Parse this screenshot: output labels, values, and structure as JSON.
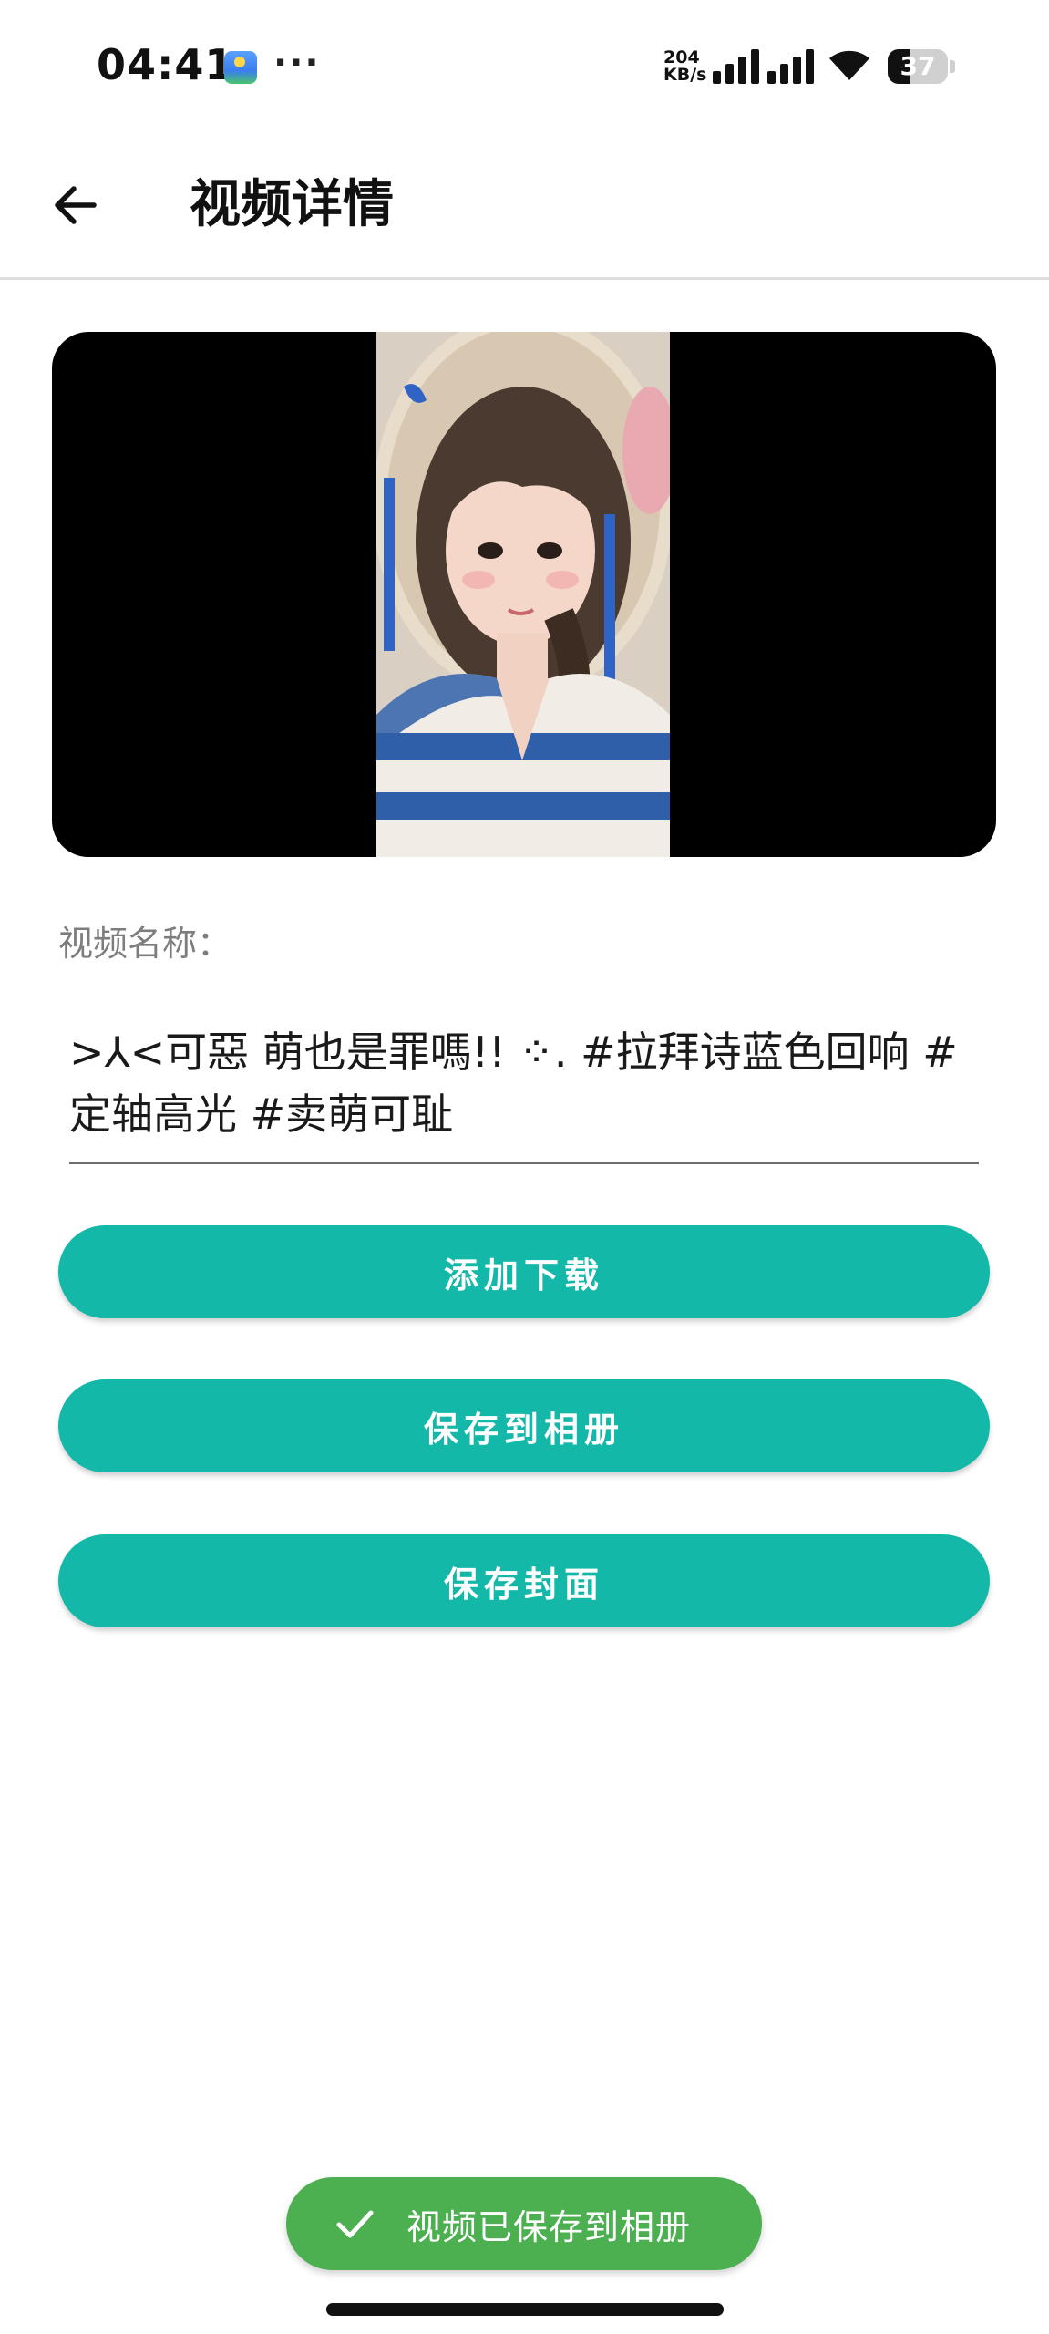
{
  "status_bar": {
    "time": "04:41",
    "more": "···",
    "net_speed_value": "204",
    "net_speed_unit": "KB/s",
    "battery_level": "37",
    "battery_fraction": 0.37
  },
  "app_bar": {
    "title": "视频详情",
    "back_icon": "arrow-left-icon"
  },
  "video": {
    "thumbnail_icon": "video-thumbnail-image"
  },
  "name": {
    "label": "视频名称：",
    "value": ">⅄<可惡 萌也是罪嗎!! ⁘. #拉拜诗蓝色回响 #定轴高光 #卖萌可耻"
  },
  "actions": {
    "add_download": "添加下载",
    "save_to_album": "保存到相册",
    "save_cover": "保存封面"
  },
  "toast": {
    "icon": "check-icon",
    "message": "视频已保存到相册"
  },
  "colors": {
    "accent": "#14b8a9",
    "toast": "#4caf50",
    "video_background": "#000000"
  }
}
